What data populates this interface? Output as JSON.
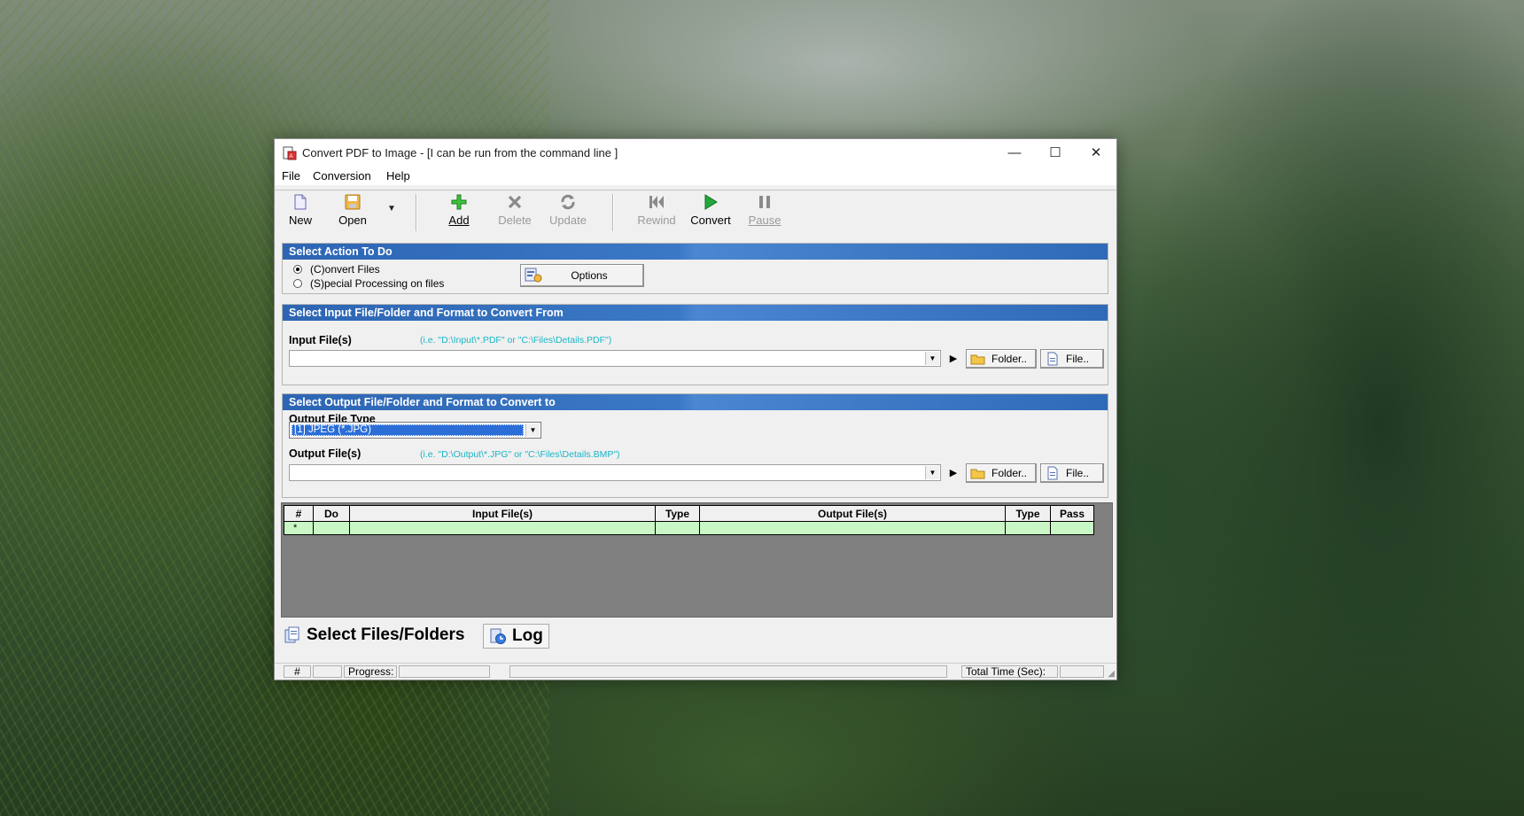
{
  "window": {
    "title": "Convert PDF to Image - [I can be run from the command line ]",
    "minimize": "—",
    "maximize": "☐",
    "close": "✕"
  },
  "menu": [
    "File",
    "Conversion",
    "Help"
  ],
  "toolbar": {
    "new": "New",
    "open": "Open",
    "open_arrow": "▼",
    "add": "Add",
    "delete": "Delete",
    "update": "Update",
    "rewind": "Rewind",
    "convert": "Convert",
    "pause": "Pause"
  },
  "action_panel": {
    "header": "Select Action To Do",
    "radio_convert": "(C)onvert Files",
    "radio_special": "(S)pecial Processing on files",
    "options_button": "Options"
  },
  "input_panel": {
    "header": "Select Input File/Folder and Format to Convert From",
    "label": "Input File(s)",
    "hint": "(i.e. \"D:\\Input\\*.PDF\"  or \"C:\\Files\\Details.PDF\")",
    "value": "",
    "play": "▶",
    "folder_button": "Folder..",
    "file_button": "File.."
  },
  "output_panel": {
    "header": "Select Output File/Folder and Format to Convert to",
    "type_label": "Output File Type",
    "type_value": "[1] JPEG (*.JPG)",
    "label": "Output File(s)",
    "hint": "(i.e. \"D:\\Output\\*.JPG\"  or \"C:\\Files\\Details.BMP\")",
    "value": "",
    "play": "▶",
    "folder_button": "Folder..",
    "file_button": "File.."
  },
  "grid": {
    "columns": [
      "#",
      "Do",
      "Input File(s)",
      "Type",
      "Output File(s)",
      "Type",
      "Pass"
    ],
    "new_row_marker": "*"
  },
  "tabs": {
    "select_files": "Select Files/Folders",
    "log": "Log"
  },
  "statusbar": {
    "hash": "#",
    "progress": "Progress:",
    "total_time": "Total Time (Sec):"
  },
  "colors": {
    "panel_header": "#2d65b3",
    "hint_text": "#19b6c8",
    "grid_row": "#c8f7c5",
    "selection": "#2b6ed8",
    "convert_green": "#22a83a"
  }
}
